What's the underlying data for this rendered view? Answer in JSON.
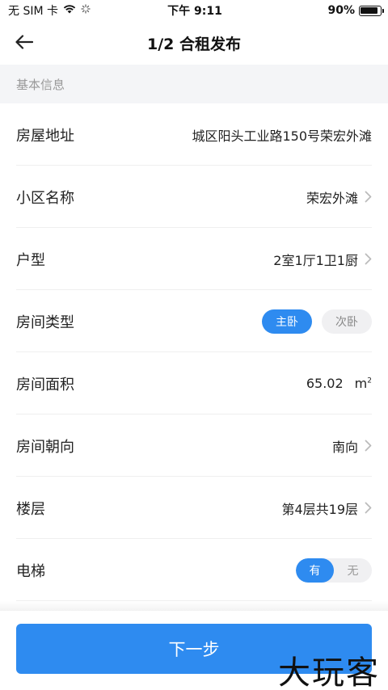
{
  "status_bar": {
    "carrier": "无 SIM 卡",
    "time": "下午 9:11",
    "battery_text": "90%",
    "battery_level": 0.9
  },
  "nav": {
    "title": "1/2 合租发布"
  },
  "section": {
    "title": "基本信息"
  },
  "rows": {
    "address": {
      "label": "房屋地址",
      "value": "城区阳头工业路150号荣宏外滩"
    },
    "community": {
      "label": "小区名称",
      "value": "荣宏外滩"
    },
    "layout": {
      "label": "户型",
      "value": "2室1厅1卫1厨"
    },
    "room_type": {
      "label": "房间类型",
      "options": [
        "主卧",
        "次卧"
      ],
      "selected": "主卧"
    },
    "area": {
      "label": "房间面积",
      "value": "65.02",
      "unit": "m",
      "unit_sup": "2"
    },
    "orientation": {
      "label": "房间朝向",
      "value": "南向"
    },
    "floor": {
      "label": "楼层",
      "value": "第4层共19层"
    },
    "elevator": {
      "label": "电梯",
      "options": [
        "有",
        "无"
      ],
      "selected": "有"
    }
  },
  "footer": {
    "next_label": "下一步"
  },
  "watermark": "大玩客",
  "colors": {
    "accent": "#2e8bf0",
    "section_bg": "#f4f5f7"
  }
}
